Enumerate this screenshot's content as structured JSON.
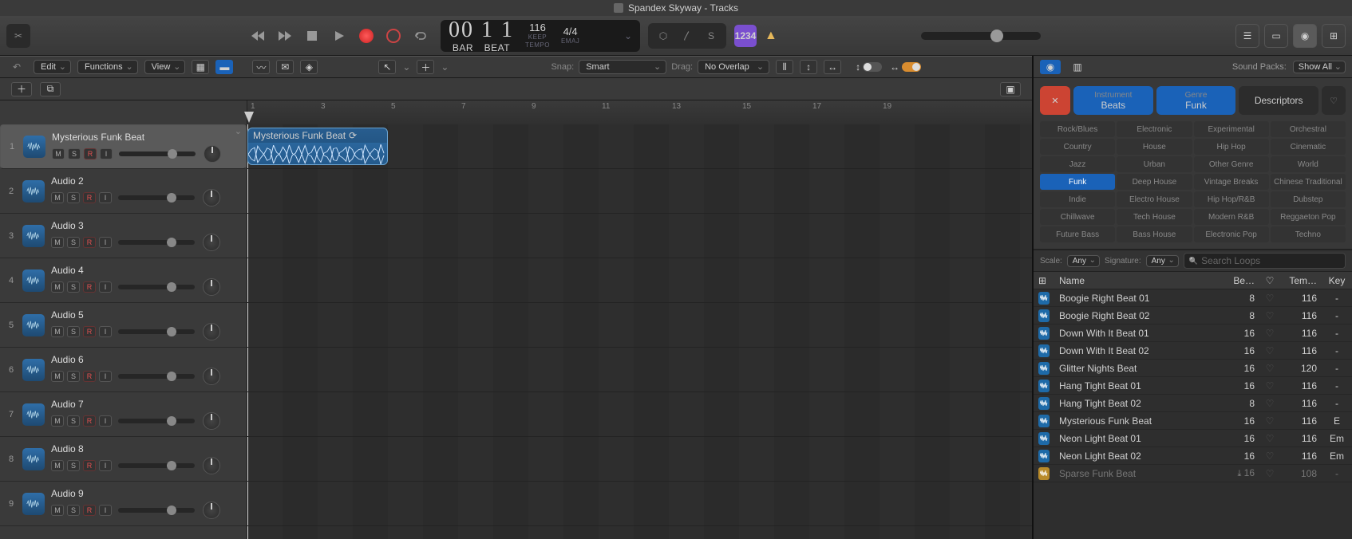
{
  "titlebar": {
    "title": "Spandex Skyway - Tracks"
  },
  "transport": {
    "lcd_main": "00 1  1",
    "tempo_val": "116",
    "tempo_lbl": "KEEP",
    "tempo_sub": "TEMPO",
    "sig_val": "4/4",
    "sig_lbl": "Emaj",
    "bar_lbl": "BAR",
    "beat_lbl": "BEAT",
    "badge": "1234"
  },
  "arrange": {
    "menus": {
      "edit": "Edit",
      "functions": "Functions",
      "view": "View"
    },
    "snap_lbl": "Snap:",
    "snap_val": "Smart",
    "drag_lbl": "Drag:",
    "drag_val": "No Overlap",
    "ruler": [
      "1",
      "3",
      "5",
      "7",
      "9",
      "11",
      "13",
      "15",
      "17",
      "19"
    ],
    "region_name": "Mysterious Funk Beat"
  },
  "tracks": [
    {
      "n": "1",
      "name": "Mysterious Funk Beat",
      "selected": true
    },
    {
      "n": "2",
      "name": "Audio 2"
    },
    {
      "n": "3",
      "name": "Audio 3"
    },
    {
      "n": "4",
      "name": "Audio 4"
    },
    {
      "n": "5",
      "name": "Audio 5"
    },
    {
      "n": "6",
      "name": "Audio 6"
    },
    {
      "n": "7",
      "name": "Audio 7"
    },
    {
      "n": "8",
      "name": "Audio 8"
    },
    {
      "n": "9",
      "name": "Audio 9"
    }
  ],
  "track_btns": {
    "m": "M",
    "s": "S",
    "r": "R",
    "i": "I"
  },
  "loops": {
    "packs_lbl": "Sound Packs:",
    "packs_val": "Show All",
    "pills": {
      "instrument_lbl": "Instrument",
      "instrument_val": "Beats",
      "genre_lbl": "Genre",
      "genre_val": "Funk",
      "descriptors": "Descriptors"
    },
    "genres": [
      "Rock/Blues",
      "Electronic",
      "Experimental",
      "Orchestral",
      "Country",
      "House",
      "Hip Hop",
      "Cinematic",
      "Jazz",
      "Urban",
      "Other Genre",
      "World",
      "Funk",
      "Deep House",
      "Vintage Breaks",
      "Chinese Traditional",
      "Indie",
      "Electro House",
      "Hip Hop/R&B",
      "Dubstep",
      "Chillwave",
      "Tech House",
      "Modern R&B",
      "Reggaeton Pop",
      "Future Bass",
      "Bass House",
      "Electronic Pop",
      "Techno"
    ],
    "genre_active": "Funk",
    "scale_lbl": "Scale:",
    "scale_val": "Any",
    "sig_lbl": "Signature:",
    "sig_val": "Any",
    "search_ph": "Search Loops",
    "cols": {
      "name": "Name",
      "beats": "Be…",
      "tempo": "Tem…",
      "key": "Key"
    },
    "rows": [
      {
        "name": "Boogie Right Beat 01",
        "beats": "8",
        "tempo": "116",
        "key": "-",
        "icon": "blue"
      },
      {
        "name": "Boogie Right Beat 02",
        "beats": "8",
        "tempo": "116",
        "key": "-",
        "icon": "blue"
      },
      {
        "name": "Down With It Beat 01",
        "beats": "16",
        "tempo": "116",
        "key": "-",
        "icon": "blue"
      },
      {
        "name": "Down With It Beat 02",
        "beats": "16",
        "tempo": "116",
        "key": "-",
        "icon": "blue"
      },
      {
        "name": "Glitter Nights Beat",
        "beats": "16",
        "tempo": "120",
        "key": "-",
        "icon": "blue"
      },
      {
        "name": "Hang Tight Beat 01",
        "beats": "16",
        "tempo": "116",
        "key": "-",
        "icon": "blue"
      },
      {
        "name": "Hang Tight Beat 02",
        "beats": "8",
        "tempo": "116",
        "key": "-",
        "icon": "blue"
      },
      {
        "name": "Mysterious Funk Beat",
        "beats": "16",
        "tempo": "116",
        "key": "E",
        "icon": "blue"
      },
      {
        "name": "Neon Light Beat 01",
        "beats": "16",
        "tempo": "116",
        "key": "Em",
        "icon": "blue"
      },
      {
        "name": "Neon Light Beat 02",
        "beats": "16",
        "tempo": "116",
        "key": "Em",
        "icon": "blue"
      },
      {
        "name": "Sparse Funk Beat",
        "beats": "16",
        "tempo": "108",
        "key": "-",
        "icon": "yel",
        "dl": true,
        "dim": true
      }
    ]
  }
}
